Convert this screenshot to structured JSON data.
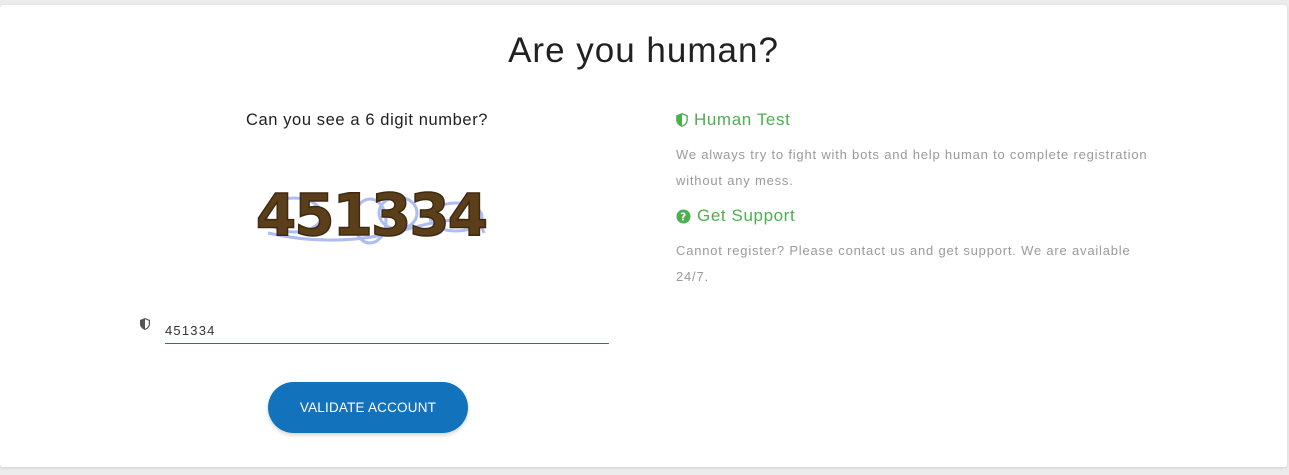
{
  "page": {
    "title": "Are you human?"
  },
  "captcha": {
    "question": "Can you see a 6 digit number?",
    "image_text": "451334",
    "input_value": "451334",
    "input_icon": "shield-icon"
  },
  "actions": {
    "validate_label": "VALIDATE ACCOUNT"
  },
  "info": {
    "human_test": {
      "icon": "shield-icon",
      "title": "Human Test",
      "text": "We always try to fight with bots and help human to complete registration without any mess."
    },
    "support": {
      "icon": "question-circle-icon",
      "title": "Get Support",
      "text": "Cannot register? Please contact us and get support. We are available 24/7."
    }
  },
  "colors": {
    "accent_green": "#4caf50",
    "button_blue": "#1272bb",
    "captcha_brown": "#5b3f1b",
    "captcha_noise": "#9fb2f2",
    "muted_text": "#9a9a9a"
  }
}
